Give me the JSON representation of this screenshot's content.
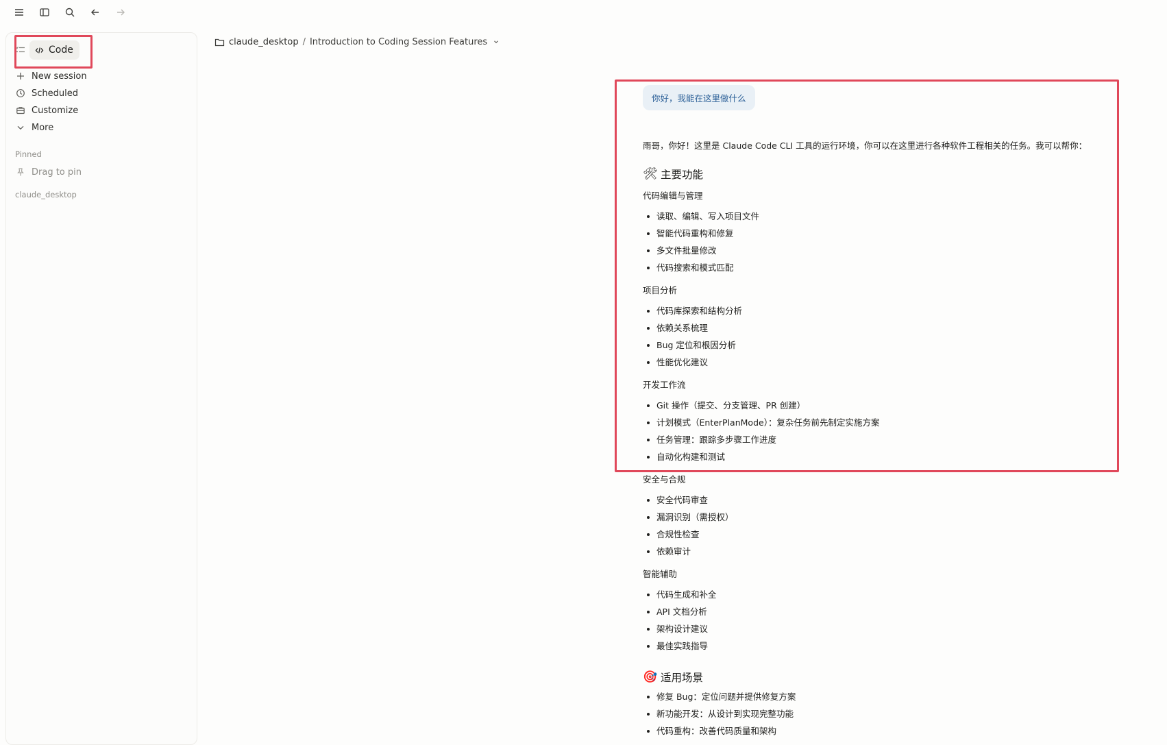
{
  "colors": {
    "accent_highlight": "#e0485a",
    "user_bubble_bg": "#e9f0f6",
    "user_bubble_text": "#2b5f97"
  },
  "toolbar": {
    "icons": [
      "menu-icon",
      "sidebar-toggle-icon",
      "search-icon",
      "back-arrow-icon",
      "forward-arrow-icon"
    ]
  },
  "sidebar": {
    "mode_label": "Code",
    "items": [
      {
        "label": "New session",
        "icon": "plus-icon"
      },
      {
        "label": "Scheduled",
        "icon": "clock-icon"
      },
      {
        "label": "Customize",
        "icon": "briefcase-icon"
      },
      {
        "label": "More",
        "icon": "chevron-down-icon"
      }
    ],
    "pinned_heading": "Pinned",
    "pin_hint": "Drag to pin",
    "project_heading": "claude_desktop"
  },
  "breadcrumb": {
    "folder": "claude_desktop",
    "separator": "/",
    "session_title": "Introduction to Coding Session Features"
  },
  "chat": {
    "user_message": "你好，我能在这里做什么",
    "intro": "雨哥，你好！这里是 Claude Code CLI 工具的运行环境，你可以在这里进行各种软件工程相关的任务。我可以帮你：",
    "section1": {
      "emoji": "🛠",
      "title": "主要功能",
      "groups": [
        {
          "title": "代码编辑与管理",
          "items": [
            "读取、编辑、写入项目文件",
            "智能代码重构和修复",
            "多文件批量修改",
            "代码搜索和模式匹配"
          ]
        },
        {
          "title": "项目分析",
          "items": [
            "代码库探索和结构分析",
            "依赖关系梳理",
            "Bug 定位和根因分析",
            "性能优化建议"
          ]
        },
        {
          "title": "开发工作流",
          "items": [
            "Git 操作（提交、分支管理、PR 创建）",
            "计划模式（EnterPlanMode）：复杂任务前先制定实施方案",
            "任务管理：跟踪多步骤工作进度",
            "自动化构建和测试"
          ]
        },
        {
          "title": "安全与合规",
          "items": [
            "安全代码审查",
            "漏洞识别（需授权）",
            "合规性检查",
            "依赖审计"
          ]
        },
        {
          "title": "智能辅助",
          "items": [
            "代码生成和补全",
            "API 文档分析",
            "架构设计建议",
            "最佳实践指导"
          ]
        }
      ]
    },
    "section2": {
      "emoji": "🎯",
      "title": "适用场景",
      "items": [
        "修复 Bug：定位问题并提供修复方案",
        "新功能开发：从设计到实现完整功能",
        "代码重构：改善代码质量和架构"
      ]
    }
  }
}
